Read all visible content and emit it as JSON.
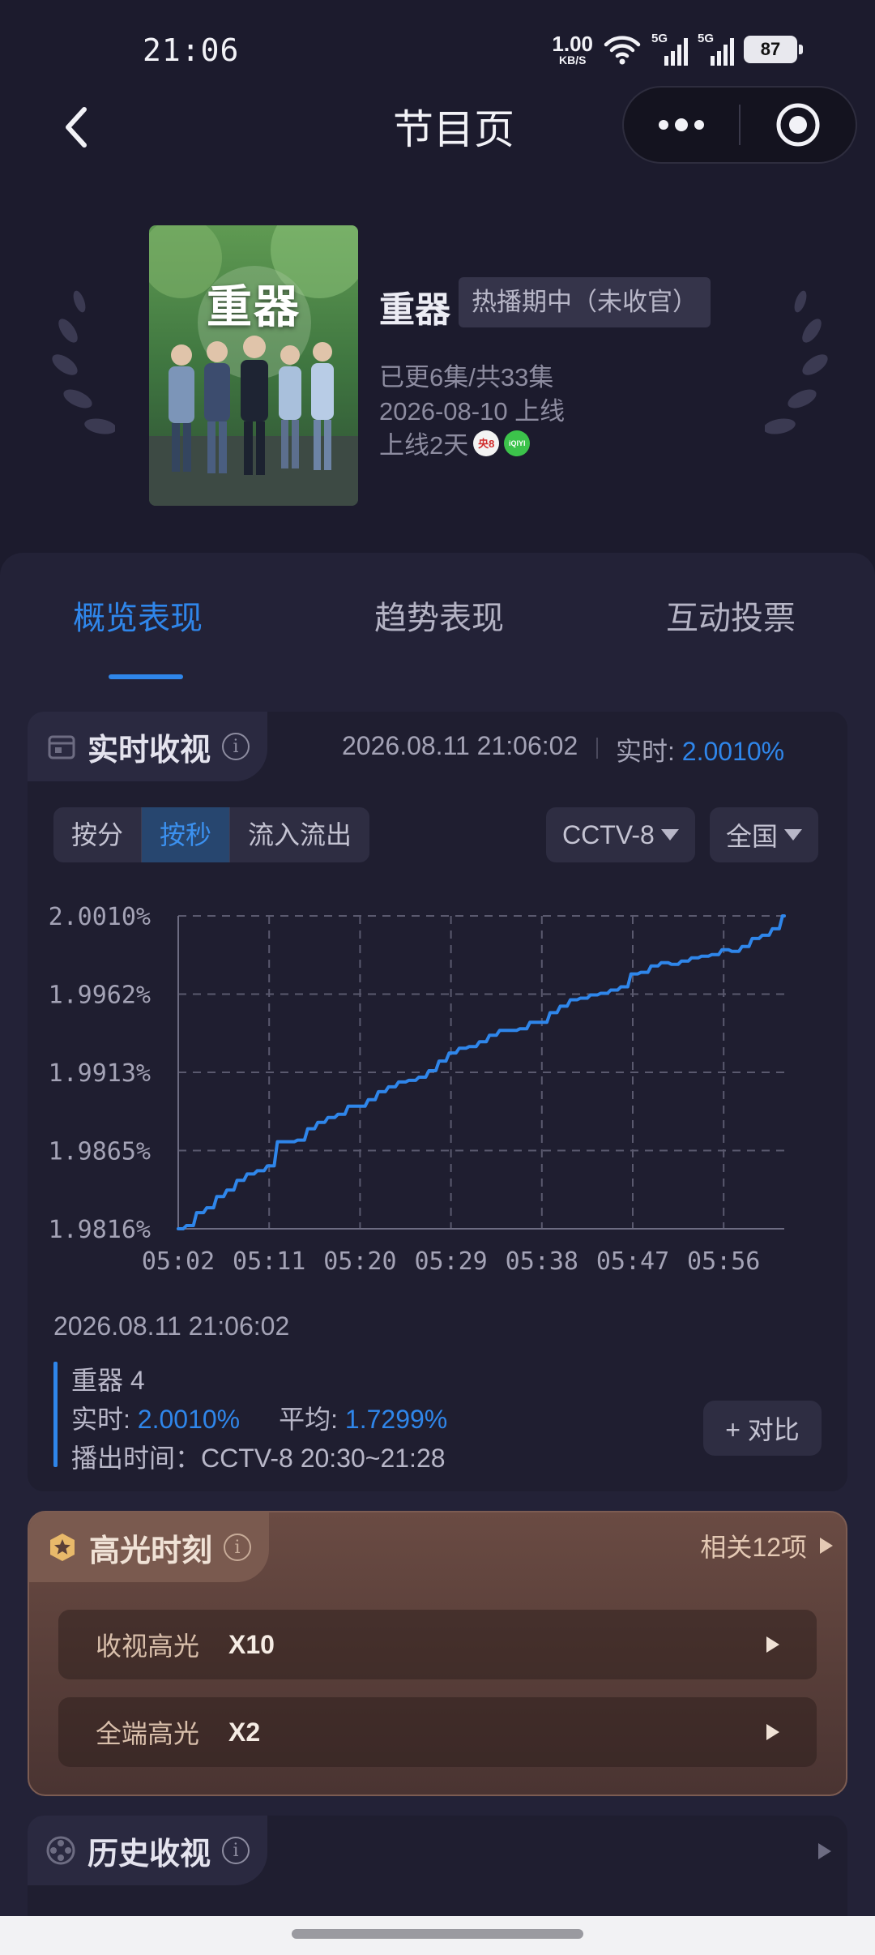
{
  "status_bar": {
    "time": "21:06",
    "net_speed_value": "1.00",
    "net_speed_unit": "KB/S",
    "signal_1": "5G",
    "signal_2": "5G",
    "battery": "87"
  },
  "nav": {
    "title": "节目页",
    "back_icon": "chevron-left-icon",
    "more_icon": "more-dots-icon",
    "target_icon": "target-circle-icon"
  },
  "show": {
    "poster_title": "重器",
    "name": "重器",
    "status_tag": "热播期中（未收官）",
    "episodes": "已更6集/共33集",
    "release": "2026-08-10 上线",
    "days_online": "上线2天",
    "channel_badge_1": "央8",
    "channel_badge_2": "iQIYI"
  },
  "tabs": [
    {
      "label": "概览表现",
      "active": true
    },
    {
      "label": "趋势表现",
      "active": false
    },
    {
      "label": "互动投票",
      "active": false
    }
  ],
  "realtime": {
    "title": "实时收视",
    "timestamp": "2026.08.11 21:06:02",
    "label": "实时: ",
    "value": "2.0010%",
    "segments": [
      "按分",
      "按秒",
      "流入流出"
    ],
    "active_segment": "按秒",
    "channel": "CCTV-8",
    "region": "全国"
  },
  "chart_data": {
    "type": "line",
    "title": "",
    "xlabel": "",
    "ylabel": "",
    "x_ticks": [
      "05:02",
      "05:11",
      "05:20",
      "05:29",
      "05:38",
      "05:47",
      "05:56"
    ],
    "y_ticks": [
      "2.0010%",
      "1.9962%",
      "1.9913%",
      "1.9865%",
      "1.9816%"
    ],
    "ylim": [
      1.9816,
      2.001
    ],
    "xlim_seconds": [
      302,
      362
    ],
    "grid": true,
    "series": [
      {
        "color": "#2f86ea",
        "x_seconds": [
          302,
          303,
          304,
          305,
          306,
          307,
          308,
          309,
          310,
          311,
          312,
          313,
          314,
          315,
          316,
          317,
          318,
          319,
          320,
          321,
          322,
          323,
          324,
          325,
          326,
          327,
          328,
          329,
          330,
          331,
          332,
          333,
          334,
          335,
          336,
          337,
          338,
          339,
          340,
          341,
          342,
          343,
          344,
          345,
          346,
          347,
          348,
          349,
          350,
          351,
          352,
          353,
          354,
          355,
          356,
          357,
          358,
          359,
          360,
          361,
          362
        ],
        "values": [
          1.9816,
          1.9818,
          1.9826,
          1.9829,
          1.9836,
          1.984,
          1.9846,
          1.985,
          1.9852,
          1.9855,
          1.987,
          1.987,
          1.9871,
          1.9878,
          1.9882,
          1.9885,
          1.9887,
          1.9892,
          1.9892,
          1.9896,
          1.9901,
          1.9904,
          1.9907,
          1.9908,
          1.991,
          1.9914,
          1.992,
          1.9925,
          1.9928,
          1.9929,
          1.9932,
          1.9936,
          1.9939,
          1.9939,
          1.994,
          1.9944,
          1.9944,
          1.995,
          1.9954,
          1.9958,
          1.9959,
          1.9961,
          1.9962,
          1.9964,
          1.9966,
          1.9974,
          1.9975,
          1.9979,
          1.9981,
          1.998,
          1.9982,
          1.9984,
          1.9985,
          1.9986,
          1.9989,
          1.9988,
          1.9991,
          1.9996,
          1.9998,
          2.0002,
          2.001
        ]
      }
    ]
  },
  "detail": {
    "date": "2026.08.11 21:06:02",
    "episode": "重器 4",
    "realtime_label": "实时: ",
    "realtime_value": "2.0010%",
    "avg_label": "平均: ",
    "avg_value": "1.7299%",
    "airtime": "播出时间：CCTV-8 20:30~21:28",
    "compare_button": "+ 对比"
  },
  "highlights": {
    "title": "高光时刻",
    "more": "相关12项",
    "rows": [
      {
        "label": "收视高光",
        "value": "X10"
      },
      {
        "label": "全端高光",
        "value": "X2"
      }
    ]
  },
  "history": {
    "title": "历史收视"
  },
  "colors": {
    "background": "#1c1b2d",
    "accent": "#2f86ea",
    "highlight_card": "#5f433c"
  }
}
